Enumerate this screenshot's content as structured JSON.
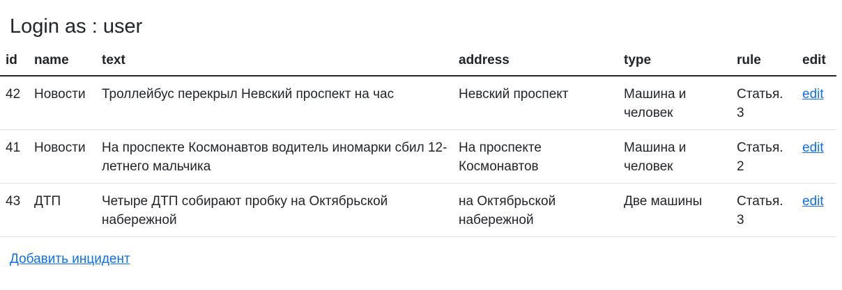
{
  "page": {
    "title": "Login as : user"
  },
  "table": {
    "columns": [
      "id",
      "name",
      "text",
      "address",
      "type",
      "rule",
      "edit"
    ],
    "rows": [
      {
        "id": "42",
        "name": "Новости",
        "text": "Троллейбус перекрыл Невский проспект на час",
        "address": "Невский проспект",
        "type": "Машина и человек",
        "rule": "Статья. 3",
        "edit": "edit"
      },
      {
        "id": "41",
        "name": "Новости",
        "text": "На проспекте Космонавтов водитель иномарки сбил 12-летнего мальчика",
        "address": "На проспекте Космонавтов",
        "type": "Машина и человек",
        "rule": "Статья. 2",
        "edit": "edit"
      },
      {
        "id": "43",
        "name": "ДТП",
        "text": "Четыре ДТП собирают пробку на Октябрьской набережной",
        "address": "на Октябрьской набережной",
        "type": "Две машины",
        "rule": "Статья. 3",
        "edit": "edit"
      }
    ]
  },
  "actions": {
    "add_incident_label": "Добавить инцидент"
  },
  "colors": {
    "text": "#212529",
    "link": "#0d6efd",
    "row_border": "#dee2e6"
  }
}
